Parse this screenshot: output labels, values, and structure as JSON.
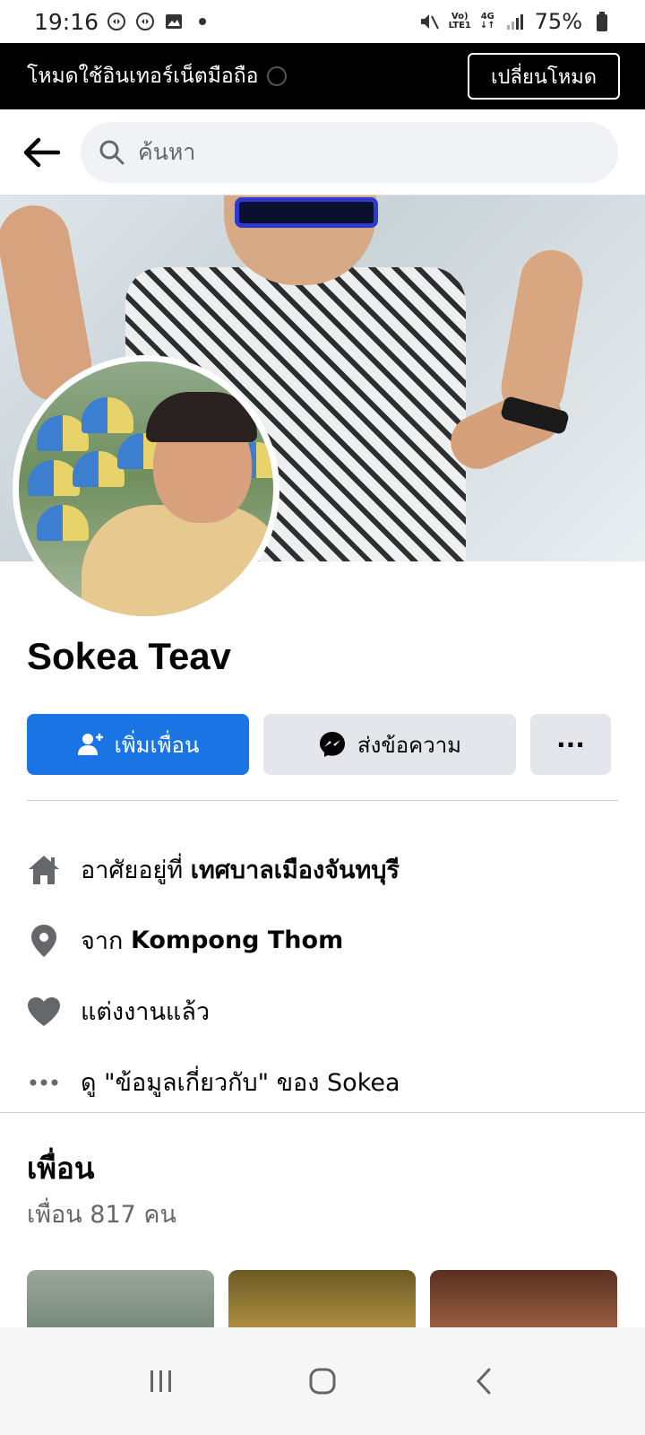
{
  "status_bar": {
    "time": "19:16",
    "battery": "75%",
    "network_top": "Vo)",
    "network_bottom": "LTE1",
    "data_top": "4G"
  },
  "mode_banner": {
    "text": "โหมดใช้อินเทอร์เน็ตมือถือ",
    "button_label": "เปลี่ยนโหมด"
  },
  "search": {
    "placeholder": "ค้นหา"
  },
  "profile": {
    "name": "Sokea Teav"
  },
  "actions": {
    "add_friend": "เพิ่มเพื่อน",
    "message": "ส่งข้อความ",
    "more": "···"
  },
  "info": {
    "lives_prefix": "อาศัยอยู่ที่ ",
    "lives_value": "เทศบาลเมืองจันทบุรี",
    "from_prefix": "จาก ",
    "from_value": "Kompong Thom",
    "relationship": "แต่งงานแล้ว",
    "about_link": "ดู \"ข้อมูลเกี่ยวกับ\" ของ Sokea"
  },
  "friends": {
    "title": "เพื่อน",
    "count": "เพื่อน 817 คน"
  },
  "colors": {
    "primary": "#1b74e4",
    "secondary_button": "#e4e6eb",
    "icon_gray": "#65676b"
  }
}
